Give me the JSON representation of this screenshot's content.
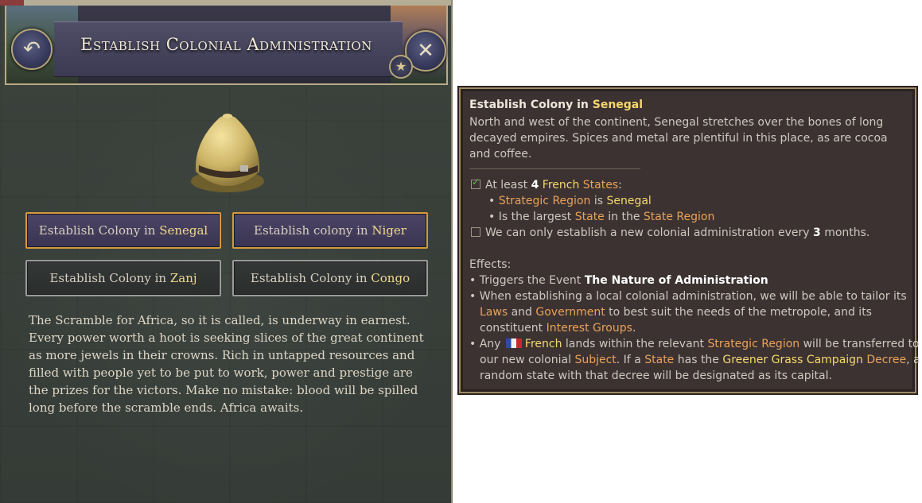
{
  "panel": {
    "title": "Establish Colonial Administration",
    "back_icon": "↶",
    "close_icon": "✕",
    "star_icon": "★",
    "image": "pith-helmet",
    "choices": [
      {
        "prefix": "Establish Colony in",
        "name": "Senegal",
        "style": "primary"
      },
      {
        "prefix": "Establish colony in",
        "name": "Niger",
        "style": "primary"
      },
      {
        "prefix": "Establish Colony in",
        "name": "Zanj",
        "style": "secondary"
      },
      {
        "prefix": "Establish Colony in",
        "name": "Congo",
        "style": "secondary"
      }
    ],
    "description": "The Scramble for Africa, so it is called, is underway in earnest. Every power worth a hoot is seeking slices of the great continent as more jewels in their crowns. Rich in untapped resources and filled with people yet to be put to work, power and prestige are the prizes for the victors. Make no mistake: blood will be spilled long before the scramble ends. Africa awaits."
  },
  "tooltip": {
    "title_prefix": "Establish Colony in",
    "title_name": "Senegal",
    "description": "North and west of the continent, Senegal stretches over the bones of long decayed empires. Spices and metal are plentiful in this place, as are cocoa and coffee.",
    "req1": {
      "prefix": "At least",
      "count": "4",
      "country": "French",
      "unit": "States",
      "colon": ":"
    },
    "req1_sub1": {
      "bullet": "•",
      "term": "Strategic Region",
      "mid": "is",
      "value": "Senegal"
    },
    "req1_sub2": {
      "bullet": "•",
      "prefix": "Is the largest",
      "term1": "State",
      "mid": "in the",
      "term2": "State Region"
    },
    "req2": {
      "text1": "We can only establish a new colonial administration every",
      "count": "3",
      "text2": "months."
    },
    "effects_label": "Effects:",
    "eff1": {
      "bullet": "•",
      "prefix": "Triggers the Event",
      "event": "The Nature of Administration"
    },
    "eff2": {
      "bullet": "•",
      "line1": "When establishing a local colonial administration, we will be able to tailor its",
      "laws": "Laws",
      "and": "and",
      "government": "Government",
      "line2_rest": "to best suit the needs of the metropole, and its",
      "line3_prefix": "constituent",
      "groups": "Interest Groups",
      "period": "."
    },
    "eff3": {
      "bullet": "•",
      "any": "Any",
      "french": "French",
      "mid": "lands within the relevant",
      "region": "Strategic Region",
      "tail": "will be transferred to",
      "line2_prefix": "our new colonial",
      "subject": "Subject",
      "if_a": ". If a",
      "state": "State",
      "has_the": "has the",
      "campaign": "Greener Grass Campaign",
      "decree": "Decree",
      "comma": ", a",
      "line3": "random state with that decree will be designated as its capital."
    },
    "colors": {
      "yellow": "#f4d86e",
      "orange": "#e9a25a",
      "panel": "#3c3232",
      "border": "#9d8b63"
    }
  }
}
